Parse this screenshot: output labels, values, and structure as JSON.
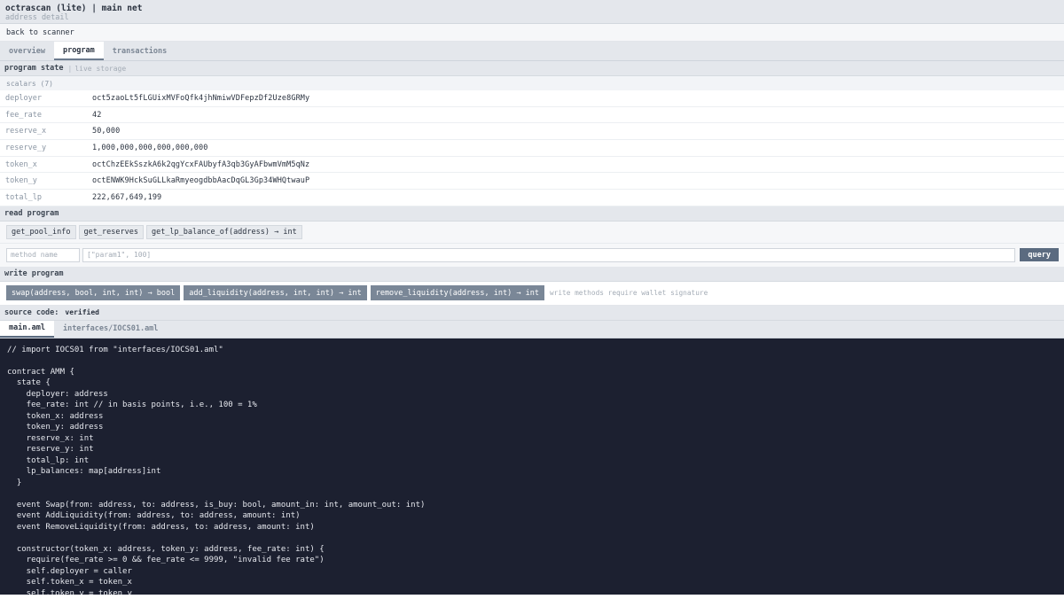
{
  "header": {
    "title": "octrascan (lite) | main net",
    "subtitle": "address detail"
  },
  "back_link": "back to scanner",
  "tabs": [
    {
      "label": "overview"
    },
    {
      "label": "program"
    },
    {
      "label": "transactions"
    }
  ],
  "program_state": {
    "title": "program state",
    "separator": "|",
    "subtitle": "live storage",
    "scalars_label": "scalars (7)",
    "rows": [
      {
        "key": "deployer",
        "value": "oct5zaoLt5fLGUixMVFoQfk4jhNmiwVDFepzDf2Uze8GRMy"
      },
      {
        "key": "fee_rate",
        "value": "42"
      },
      {
        "key": "reserve_x",
        "value": "50,000"
      },
      {
        "key": "reserve_y",
        "value": "1,000,000,000,000,000,000"
      },
      {
        "key": "token_x",
        "value": "octChzEEkSszkA6k2qgYcxFAUbyfA3qb3GyAFbwmVmM5qNz"
      },
      {
        "key": "token_y",
        "value": "octENWK9HckSuGLLkaRmyeogdbbAacDqGL3Gp34WHQtwauP"
      },
      {
        "key": "total_lp",
        "value": "222,667,649,199"
      }
    ]
  },
  "read_program": {
    "title": "read program",
    "methods": [
      {
        "label": "get_pool_info"
      },
      {
        "label": "get_reserves"
      },
      {
        "label": "get_lp_balance_of(address) → int"
      }
    ],
    "method_placeholder": "method name",
    "params_placeholder": "[\"param1\", 100]",
    "query_label": "query"
  },
  "write_program": {
    "title": "write program",
    "methods": [
      {
        "label": "swap(address, bool, int, int) → bool"
      },
      {
        "label": "add_liquidity(address, int, int) → int"
      },
      {
        "label": "remove_liquidity(address, int) → int"
      }
    ],
    "note": "write methods require wallet signature"
  },
  "source": {
    "title": "source code:",
    "status": "verified",
    "files": [
      {
        "label": "main.aml"
      },
      {
        "label": "interfaces/IOCS01.aml"
      }
    ],
    "code": "// import IOCS01 from \"interfaces/IOCS01.aml\"\n\ncontract AMM {\n  state {\n    deployer: address\n    fee_rate: int // in basis points, i.e., 100 = 1%\n    token_x: address\n    token_y: address\n    reserve_x: int\n    reserve_y: int\n    total_lp: int\n    lp_balances: map[address]int\n  }\n\n  event Swap(from: address, to: address, is_buy: bool, amount_in: int, amount_out: int)\n  event AddLiquidity(from: address, to: address, amount: int)\n  event RemoveLiquidity(from: address, to: address, amount: int)\n\n  constructor(token_x: address, token_y: address, fee_rate: int) {\n    require(fee_rate >= 0 && fee_rate <= 9999, \"invalid fee rate\")\n    self.deployer = caller\n    self.token_x = token_x\n    self.token_y = token_y"
  }
}
